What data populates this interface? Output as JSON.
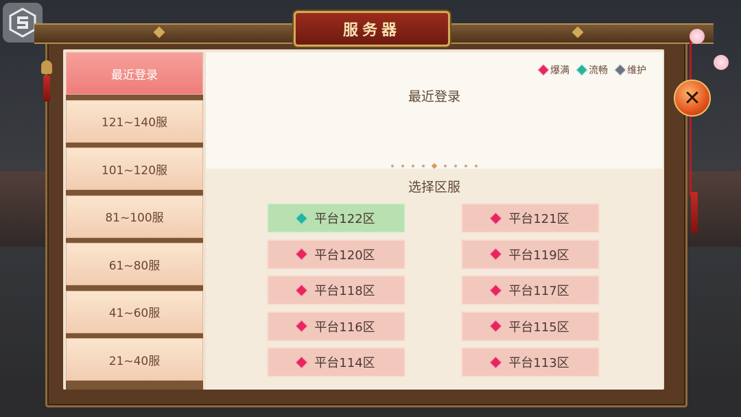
{
  "title": "服务器",
  "legend": [
    {
      "label": "爆满",
      "color": "#e8265e"
    },
    {
      "label": "流畅",
      "color": "#22b59a"
    },
    {
      "label": "维护",
      "color": "#6b7380"
    }
  ],
  "sidebar": {
    "items": [
      {
        "label": "最近登录",
        "active": true
      },
      {
        "label": "121~140服",
        "active": false
      },
      {
        "label": "101~120服",
        "active": false
      },
      {
        "label": "81~100服",
        "active": false
      },
      {
        "label": "61~80服",
        "active": false
      },
      {
        "label": "41~60服",
        "active": false
      },
      {
        "label": "21~40服",
        "active": false
      }
    ]
  },
  "recent_title": "最近登录",
  "select_title": "选择区服",
  "servers": [
    {
      "label": "平台122区",
      "status": "流畅",
      "color": "#22b59a"
    },
    {
      "label": "平台121区",
      "status": "爆满",
      "color": "#e8265e"
    },
    {
      "label": "平台120区",
      "status": "爆满",
      "color": "#e8265e"
    },
    {
      "label": "平台119区",
      "status": "爆满",
      "color": "#e8265e"
    },
    {
      "label": "平台118区",
      "status": "爆满",
      "color": "#e8265e"
    },
    {
      "label": "平台117区",
      "status": "爆满",
      "color": "#e8265e"
    },
    {
      "label": "平台116区",
      "status": "爆满",
      "color": "#e8265e"
    },
    {
      "label": "平台115区",
      "status": "爆满",
      "color": "#e8265e"
    },
    {
      "label": "平台114区",
      "status": "爆满",
      "color": "#e8265e"
    },
    {
      "label": "平台113区",
      "status": "爆满",
      "color": "#e8265e"
    }
  ],
  "close_icon": "close-icon",
  "colors": {
    "active_tab": "#ee7d79",
    "selected_server": "#b8e0b0",
    "server_default": "#f2c8bd"
  }
}
